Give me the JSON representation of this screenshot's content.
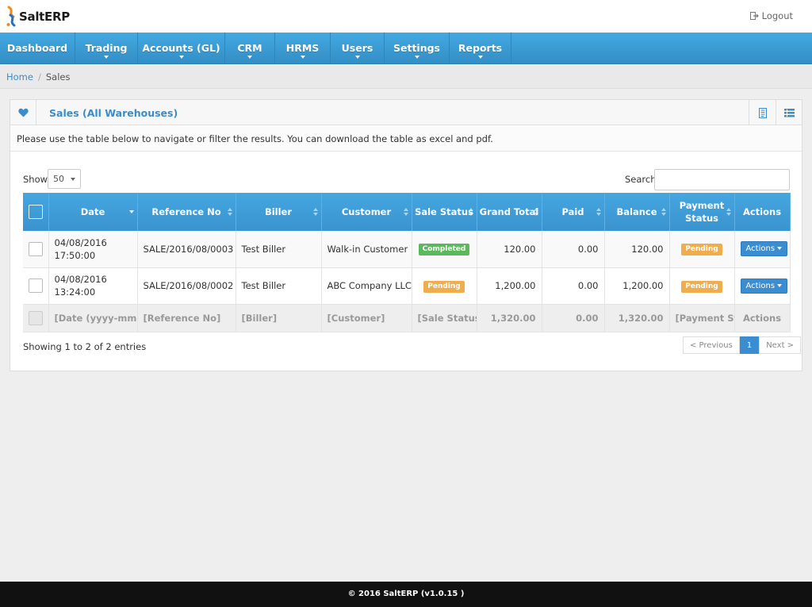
{
  "brand": {
    "name_prefix": "Salt",
    "name_suffix": "ERP"
  },
  "header": {
    "logout_label": "Logout"
  },
  "nav": [
    {
      "label": "Dashboard",
      "has_caret": false
    },
    {
      "label": "Trading",
      "has_caret": true
    },
    {
      "label": "Accounts (GL)",
      "has_caret": true
    },
    {
      "label": "CRM",
      "has_caret": true
    },
    {
      "label": "HRMS",
      "has_caret": true
    },
    {
      "label": "Users",
      "has_caret": true
    },
    {
      "label": "Settings",
      "has_caret": true
    },
    {
      "label": "Reports",
      "has_caret": true
    }
  ],
  "breadcrumb": {
    "home": "Home",
    "separator": "/",
    "current": "Sales"
  },
  "panel": {
    "title": "Sales (All Warehouses)",
    "intro": "Please use the table below to navigate or filter the results. You can download the table as excel and pdf."
  },
  "controls": {
    "show_label": "Show",
    "show_value": "50",
    "search_label": "Search",
    "search_value": ""
  },
  "table": {
    "headers": [
      "Date",
      "Reference No",
      "Biller",
      "Customer",
      "Sale Status",
      "Grand Total",
      "Paid",
      "Balance",
      "Payment Status",
      "Actions"
    ],
    "rows": [
      {
        "date_line1": "04/08/2016",
        "date_line2": "17:50:00",
        "reference": "SALE/2016/08/0003",
        "biller": "Test Biller",
        "customer": "Walk-in Customer",
        "sale_status": "Completed",
        "grand_total": "120.00",
        "paid": "0.00",
        "balance": "120.00",
        "payment_status": "Pending",
        "actions": "Actions"
      },
      {
        "date_line1": "04/08/2016",
        "date_line2": "13:24:00",
        "reference": "SALE/2016/08/0002",
        "biller": "Test Biller",
        "customer": "ABC Company LLC",
        "sale_status": "Pending",
        "grand_total": "1,200.00",
        "paid": "0.00",
        "balance": "1,200.00",
        "payment_status": "Pending",
        "actions": "Actions"
      }
    ],
    "footer": {
      "date": "[Date (yyyy-mm-dd)]",
      "reference": "[Reference No]",
      "biller": "[Biller]",
      "customer": "[Customer]",
      "sale_status": "[Sale Status]",
      "grand_total": "1,320.00",
      "paid": "0.00",
      "balance": "1,320.00",
      "payment_status": "[Payment Status]",
      "actions": "Actions"
    }
  },
  "pagination": {
    "info": "Showing 1 to 2 of 2 entries",
    "prev": "< Previous",
    "current": "1",
    "next": "Next >"
  },
  "footer": {
    "text": "© 2016 SaltERP (v1.0.15 )"
  },
  "colors": {
    "accent": "#3a9dd6",
    "success": "#5cb85c",
    "warning": "#f0ad4e",
    "logo_orange": "#f08a1c",
    "logo_blue": "#2f6db5"
  }
}
